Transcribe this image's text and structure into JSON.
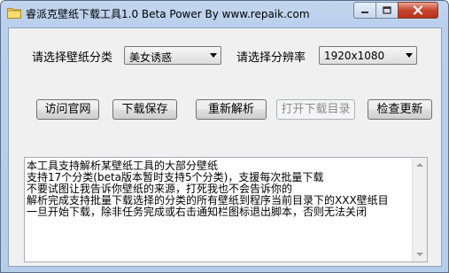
{
  "window": {
    "title": "睿派克壁纸下载工具1.0 Beta Power By www.repaik.com",
    "icon": "folder-icon"
  },
  "form": {
    "category_label": "请选择壁纸分类",
    "category_value": "美女诱惑",
    "resolution_label": "请选择分辨率",
    "resolution_value": "1920x1080"
  },
  "buttons": {
    "visit_site": "访问官网",
    "download_save": "下载保存",
    "reparse": "重新解析",
    "open_download_dir": "打开下载目录",
    "check_update": "检查更新"
  },
  "info_lines": [
    "本工具支持解析某壁纸工具的大部分壁纸",
    "支持17个分类(beta版本暂时支持5个分类)，支援每次批量下载",
    "不要试图让我告诉你壁纸的来源，打死我也不会告诉你的",
    "解析完成支持批量下载选择的分类的所有壁纸到程序当前目录下的XXX壁纸目",
    "一旦开始下载，除非任务完成或右击通知栏图标退出脚本，否则无法关闭"
  ],
  "colors": {
    "title_bg": "#b9cfec",
    "client_bg": "#f0f0f0",
    "close_red": "#c7442c"
  }
}
